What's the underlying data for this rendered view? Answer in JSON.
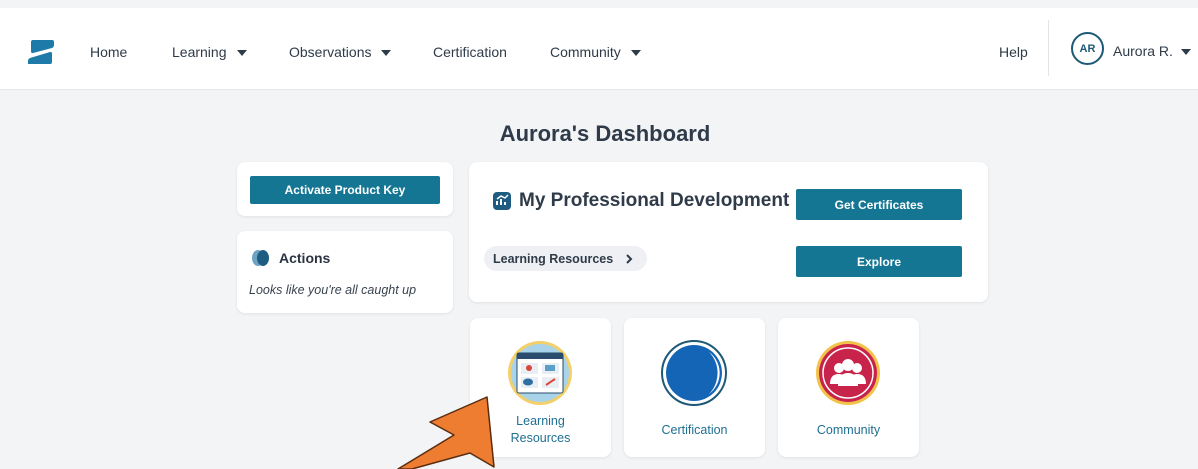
{
  "nav": {
    "items": [
      {
        "label": "Home",
        "has_dropdown": false
      },
      {
        "label": "Learning",
        "has_dropdown": true
      },
      {
        "label": "Observations",
        "has_dropdown": true
      },
      {
        "label": "Certification",
        "has_dropdown": false
      },
      {
        "label": "Community",
        "has_dropdown": true
      }
    ],
    "help": "Help",
    "user": {
      "initials": "AR",
      "name": "Aurora R."
    }
  },
  "page_title": "Aurora's Dashboard",
  "activate_button": "Activate Product Key",
  "actions": {
    "title": "Actions",
    "message": "Looks like you're all caught up"
  },
  "pd": {
    "title": "My Professional Development",
    "certificates_button": "Get Certificates",
    "resources_link": "Learning Resources",
    "explore_button": "Explore"
  },
  "tiles": [
    {
      "label_line1": "Learning",
      "label_line2": "Resources"
    },
    {
      "label": "Certification"
    },
    {
      "label": "Community"
    }
  ],
  "colors": {
    "accent": "#147693",
    "navy": "#1e5877",
    "community": "#c8234a",
    "arrow": "#ee7d31"
  }
}
